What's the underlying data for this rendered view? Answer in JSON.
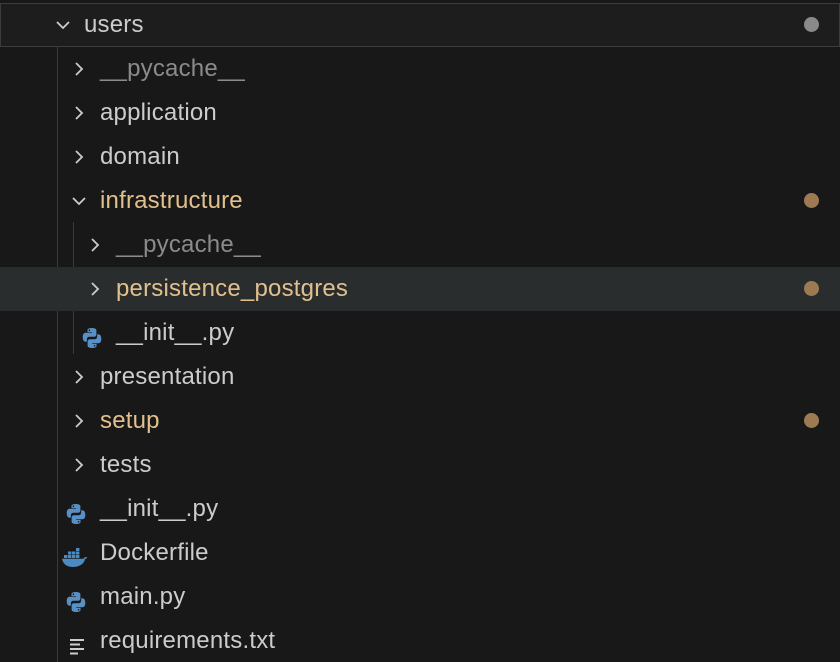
{
  "colors": {
    "background": "#181818",
    "hover_row": "#2a2d2e",
    "text_default": "#cccccc",
    "text_ignored": "#8b8b8b",
    "text_modified": "#e2c08d",
    "dot_modified": "#9e7a53",
    "dot_root": "#8a8a8a",
    "python_blue": "#5a8fc4",
    "docker_blue": "#4c8bc1",
    "indent_guide": "#3a3a3a"
  },
  "explorer": {
    "root": {
      "label": "users",
      "expanded": true,
      "icon": "chevron-down-icon",
      "decoration": "dot"
    },
    "items": [
      {
        "label": "__pycache__",
        "type": "folder",
        "expanded": false,
        "status": "ignored"
      },
      {
        "label": "application",
        "type": "folder",
        "expanded": false,
        "status": "normal"
      },
      {
        "label": "domain",
        "type": "folder",
        "expanded": false,
        "status": "normal"
      },
      {
        "label": "infrastructure",
        "type": "folder",
        "expanded": true,
        "status": "modified"
      },
      {
        "label": "__pycache__",
        "type": "folder",
        "expanded": false,
        "status": "ignored"
      },
      {
        "label": "persistence_postgres",
        "type": "folder",
        "expanded": false,
        "status": "modified"
      },
      {
        "label": "__init__.py",
        "type": "file",
        "icon": "python-icon",
        "status": "normal"
      },
      {
        "label": "presentation",
        "type": "folder",
        "expanded": false,
        "status": "normal"
      },
      {
        "label": "setup",
        "type": "folder",
        "expanded": false,
        "status": "modified"
      },
      {
        "label": "tests",
        "type": "folder",
        "expanded": false,
        "status": "normal"
      },
      {
        "label": "__init__.py",
        "type": "file",
        "icon": "python-icon",
        "status": "normal"
      },
      {
        "label": "Dockerfile",
        "type": "file",
        "icon": "docker-icon",
        "status": "normal"
      },
      {
        "label": "main.py",
        "type": "file",
        "icon": "python-icon",
        "status": "normal"
      },
      {
        "label": "requirements.txt",
        "type": "file",
        "icon": "text-lines-icon",
        "status": "normal"
      }
    ]
  }
}
